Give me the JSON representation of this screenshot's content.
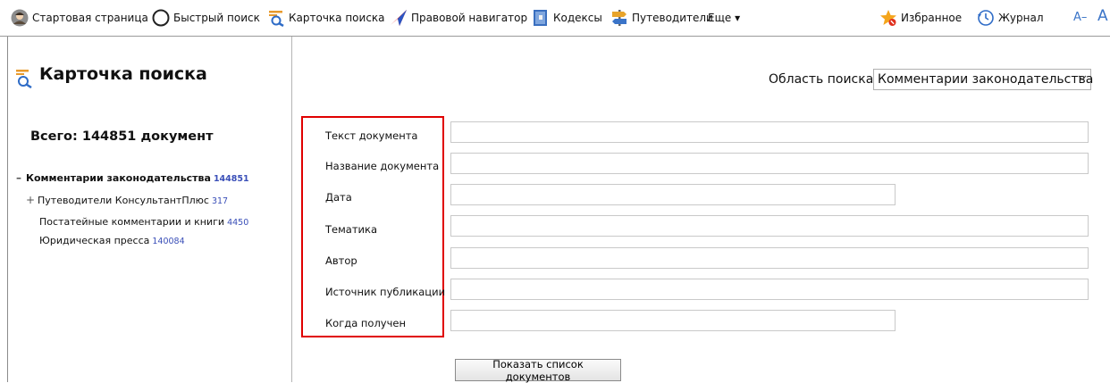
{
  "toolbar": {
    "items": [
      {
        "label": "Стартовая страница",
        "icon": "avatar-icon"
      },
      {
        "label": "Быстрый поиск",
        "icon": "quick-search-icon"
      },
      {
        "label": "Карточка поиска",
        "icon": "search-card-icon"
      },
      {
        "label": "Правовой навигатор",
        "icon": "legal-navigator-icon"
      },
      {
        "label": "Кодексы",
        "icon": "codes-icon"
      },
      {
        "label": "Путеводители",
        "icon": "guides-icon"
      },
      {
        "label": "Еще ▾",
        "icon": ""
      }
    ],
    "favorites": "Избранное",
    "journal": "Журнал",
    "font_smaller": "A–",
    "font_larger": "A"
  },
  "sidebar": {
    "title": "Карточка поиска",
    "total": "Всего: 144851 документ",
    "tree": [
      {
        "label": "Комментарии законодательства",
        "count": "144851",
        "expander": "–"
      },
      {
        "label": "Путеводители КонсультантПлюс",
        "count": "317",
        "expander": "+"
      },
      {
        "label": "Постатейные комментарии и книги",
        "count": "4450",
        "expander": ""
      },
      {
        "label": "Юридическая пресса",
        "count": "140084",
        "expander": ""
      }
    ]
  },
  "main": {
    "scope_label": "Область поиска",
    "scope_value": "Комментарии законодательства",
    "fields": [
      {
        "label": "Текст документа",
        "value": ""
      },
      {
        "label": "Название документа",
        "value": ""
      },
      {
        "label": "Дата",
        "value": ""
      },
      {
        "label": "Тематика",
        "value": ""
      },
      {
        "label": "Автор",
        "value": ""
      },
      {
        "label": "Источник публикации",
        "value": ""
      },
      {
        "label": "Когда получен",
        "value": ""
      }
    ],
    "show_button": "Показать список документов"
  },
  "colors": {
    "highlight": "#e00000",
    "accent": "#3a74c8",
    "count": "#3a4fb8"
  }
}
